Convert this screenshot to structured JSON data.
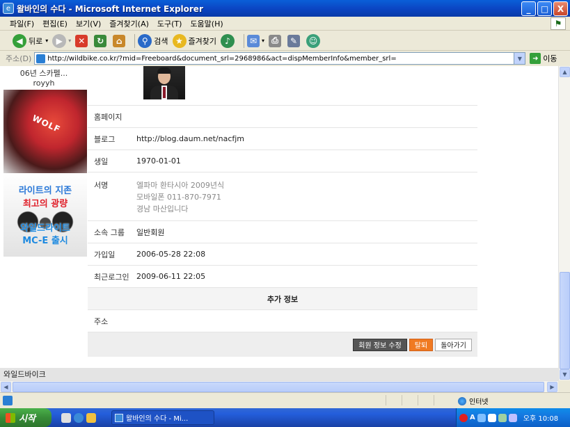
{
  "window": {
    "title": "왈바인의 수다 - Microsoft Internet Explorer",
    "controls": {
      "minimize": "_",
      "maximize": "□",
      "close": "X"
    }
  },
  "menu": {
    "items": [
      "파일(F)",
      "편집(E)",
      "보기(V)",
      "즐겨찾기(A)",
      "도구(T)",
      "도움말(H)"
    ]
  },
  "toolbar": {
    "back_label": "뒤로",
    "search_label": "검색",
    "favorites_label": "즐겨찾기"
  },
  "address": {
    "label": "주소(D)",
    "url": "http://wildbike.co.kr/?mid=Freeboard&document_srl=2968986&act=dispMemberInfo&member_srl=",
    "go_label": "이동"
  },
  "sidebar": {
    "thumb_title": "06년 스카펠...",
    "thumb_author": "royyh",
    "photo_ad_brand": "WOLF",
    "ad_lines": [
      "라이트의 지존",
      "최고의 광량",
      "와일드라이트",
      "MC-E 출시"
    ]
  },
  "profile": {
    "fields": {
      "homepage": {
        "label": "홈페이지",
        "value": ""
      },
      "blog": {
        "label": "블로그",
        "value": "http://blog.daum.net/nacfjm"
      },
      "birthday": {
        "label": "생일",
        "value": "1970-01-01"
      },
      "signature": {
        "label": "서명",
        "lines": [
          "엘파마 환타시아 2009년식",
          "모바일폰 011-870-7971",
          "경남 마산입니다"
        ]
      },
      "group": {
        "label": "소속 그룹",
        "value": "일반회원"
      },
      "joined": {
        "label": "가입일",
        "value": "2006-05-28 22:08"
      },
      "last_login": {
        "label": "최근로그인",
        "value": "2009-06-11 22:05"
      }
    },
    "extra_section_title": "추가 정보",
    "address_field": {
      "label": "주소",
      "value": ""
    },
    "buttons": {
      "edit": "회원 정보 수정",
      "withdraw": "탈퇴",
      "back": "돌아가기"
    }
  },
  "page_footer": "와일드바이크",
  "status": {
    "zone": "인터넷"
  },
  "taskbar": {
    "start_label": "시작",
    "task_label": "왈바인의 수다 - Mi...",
    "clock": "오후 10:08"
  }
}
